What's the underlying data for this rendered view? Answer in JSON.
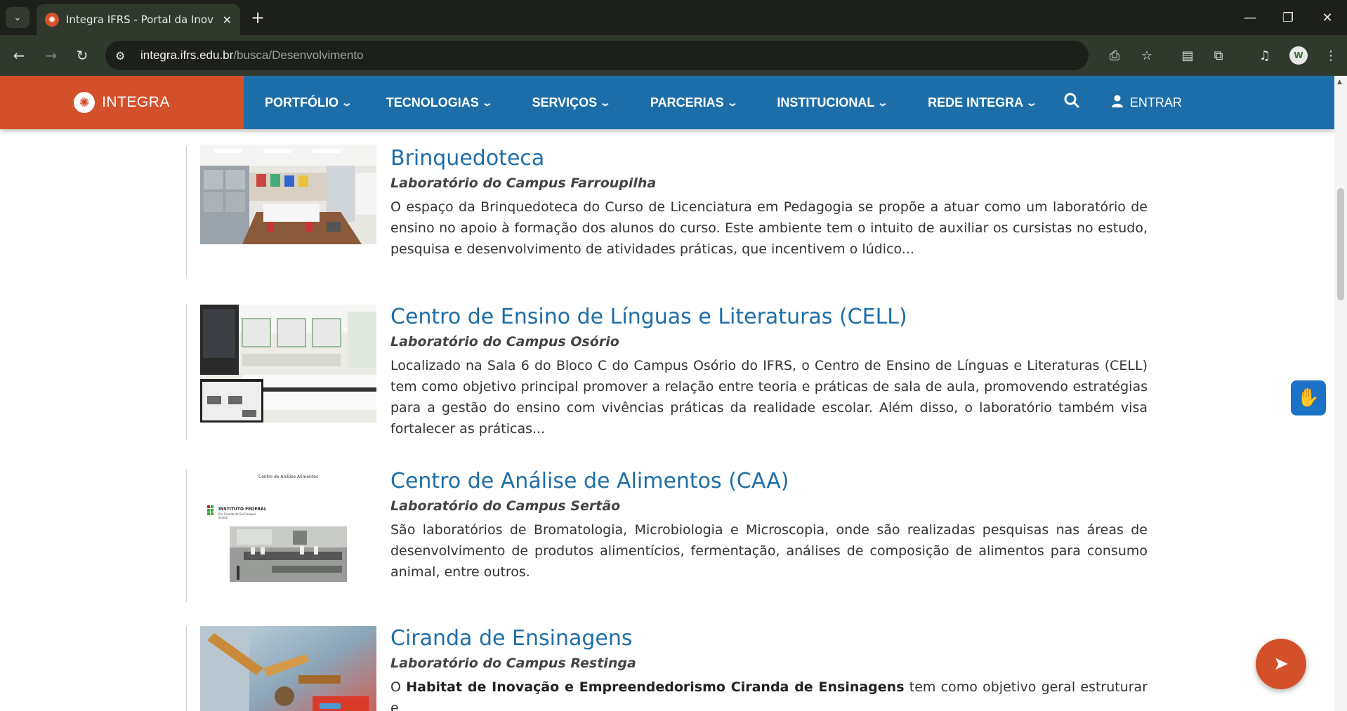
{
  "browser": {
    "tab_title": "Integra IFRS - Portal da Inovação",
    "tab_close": "✕",
    "new_tab": "+",
    "url_host": "integra.ifrs.edu.br",
    "url_path": "/busca/Desenvolvimento",
    "profile_initial": "W"
  },
  "site_nav": {
    "brand": "INTEGRA",
    "menu": [
      {
        "label": "PORTFÓLIO"
      },
      {
        "label": "TECNOLOGIAS"
      },
      {
        "label": "SERVIÇOS"
      },
      {
        "label": "PARCERIAS"
      },
      {
        "label": "INSTITUCIONAL"
      },
      {
        "label": "REDE INTEGRA"
      }
    ],
    "login": "ENTRAR"
  },
  "results": [
    {
      "title": "Brinquedoteca",
      "subtitle": "Laboratório do Campus Farroupilha",
      "description": "O espaço da Brinquedoteca do Curso de Licenciatura em Pedagogia se propõe a atuar como um laboratório de ensino no apoio à formação dos alunos do curso. Este ambiente tem o intuito de auxiliar os cursistas no estudo, pesquisa e desenvolvimento de atividades práticas, que incentivem o lúdico..."
    },
    {
      "title": "Centro de Ensino de Línguas e Literaturas (CELL)",
      "subtitle": "Laboratório do Campus Osório",
      "description": "Localizado na Sala 6 do Bloco C do Campus Osório do IFRS, o Centro de Ensino de Línguas e Literaturas (CELL) tem como objetivo principal promover a relação entre teoria e práticas de sala de aula, promovendo estratégias para a gestão do ensino com vivências práticas da realidade escolar. Além disso, o laboratório também visa fortalecer as práticas..."
    },
    {
      "title": "Centro de Análise de Alimentos (CAA)",
      "subtitle": "Laboratório do Campus Sertão",
      "description": "São laboratórios de Bromatologia, Microbiologia e Microscopia, onde são realizadas pesquisas nas áreas de desenvolvimento de produtos alimentícios, fermentação, análises de composição de alimentos para consumo animal, entre outros.",
      "thumb_caption": "Centro de Análise Alimentos",
      "thumb_logo_text": "INSTITUTO FEDERAL",
      "thumb_logo_sub": "Rio Grande do Sul Campus Sertão"
    },
    {
      "title": "Ciranda de Ensinagens",
      "subtitle": "Laboratório do Campus Restinga",
      "description_prefix": "O ",
      "description_bold": "Habitat de Inovação e Empreendedorismo Ciranda de Ensinagens",
      "description_suffix": " tem como objetivo geral estruturar e"
    }
  ]
}
